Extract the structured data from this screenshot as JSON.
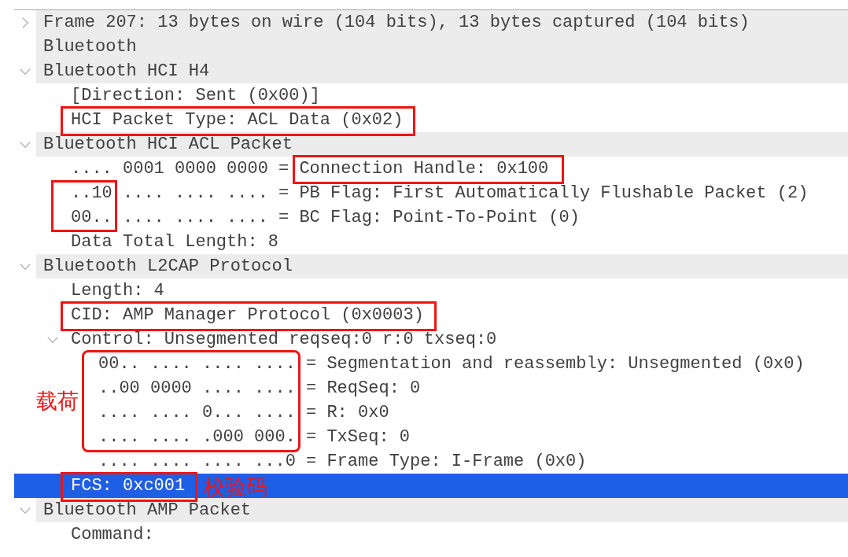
{
  "tree": [
    {
      "text": "Frame 207: 13 bytes on wire (104 bits), 13 bytes captured (104 bits)",
      "expanded": false,
      "selected": false
    },
    {
      "text": "Bluetooth",
      "selected": false
    },
    {
      "text": "Bluetooth HCI H4",
      "expanded": true,
      "selected": false,
      "children": [
        {
          "text": "[Direction: Sent (0x00)]",
          "selected": false
        },
        {
          "text": "HCI Packet Type: ACL Data (0x02)",
          "selected": false,
          "boxed": true
        }
      ]
    },
    {
      "text": "Bluetooth HCI ACL Packet",
      "expanded": true,
      "selected": false,
      "children": [
        {
          "bits": ".... 0001 0000 0000",
          "sep": "=",
          "text": "Connection Handle: 0x100",
          "selected": false,
          "field_boxed": true
        },
        {
          "bits": "..10 .... .... ....",
          "sep": "=",
          "text": "PB Flag: First Automatically Flushable Packet (2)",
          "selected": false,
          "head_boxed": true
        },
        {
          "bits": "00.. .... .... ....",
          "sep": "=",
          "text": "BC Flag: Point-To-Point (0)",
          "selected": false,
          "head_boxed": true
        },
        {
          "text": "Data Total Length: 8",
          "selected": false
        }
      ]
    },
    {
      "text": "Bluetooth L2CAP Protocol",
      "expanded": true,
      "selected": false,
      "children": [
        {
          "text": "Length: 4",
          "selected": false
        },
        {
          "text": "CID: AMP Manager Protocol (0x0003)",
          "selected": false,
          "boxed": true
        },
        {
          "text": "Control: Unsegmented reqseq:0 r:0 txseq:0",
          "expanded": true,
          "selected": false,
          "children": [
            {
              "bits": "00.. .... .... ....",
              "sep": "=",
              "text": "Segmentation and reassembly: Unsegmented (0x0)",
              "selected": false,
              "bits_boxed": true,
              "note": {
                "text": "载荷",
                "before": true
              }
            },
            {
              "bits": "..00 0000 .... ....",
              "sep": "=",
              "text": "ReqSeq: 0",
              "selected": false,
              "bits_boxed": true
            },
            {
              "bits": ".... .... 0... ....",
              "sep": "=",
              "text": "R: 0x0",
              "selected": false,
              "bits_boxed": true
            },
            {
              "bits": ".... .... .000 000.",
              "sep": "=",
              "text": "TxSeq: 0",
              "selected": false,
              "bits_boxed": true
            },
            {
              "bits": ".... .... .... ...0",
              "sep": "=",
              "text": "Frame Type: I-Frame (0x0)",
              "selected": false
            }
          ]
        },
        {
          "text": "FCS: 0xc001",
          "selected": true,
          "boxed": true,
          "note": {
            "text": "校验码",
            "before": false
          }
        }
      ]
    },
    {
      "text": "Bluetooth AMP Packet",
      "expanded": true,
      "selected": false,
      "children": [
        {
          "text": "Command:",
          "selected": false
        }
      ]
    }
  ]
}
